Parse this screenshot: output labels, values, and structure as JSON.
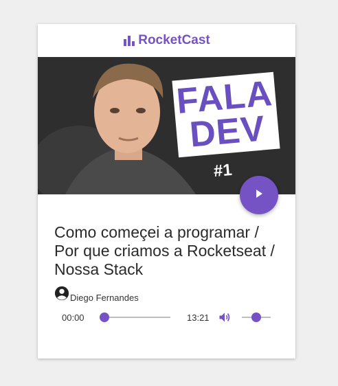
{
  "app": {
    "brand": "RocketCast",
    "accent": "#7553c4"
  },
  "episode": {
    "thumbnail": {
      "show_title_line1": "FALA",
      "show_title_line2": "DEV",
      "episode_tag": "#1"
    },
    "title": "Como começei a programar / Por que criamos a Rocketseat / Nossa Stack",
    "author": "Diego Fernandes"
  },
  "player": {
    "current_time": "00:00",
    "duration": "13:21",
    "progress": 0,
    "volume": 0.5,
    "icons": {
      "play": "play-icon",
      "volume": "volume-up-icon",
      "author": "account-circle-icon",
      "logo": "bar-chart-icon"
    }
  }
}
